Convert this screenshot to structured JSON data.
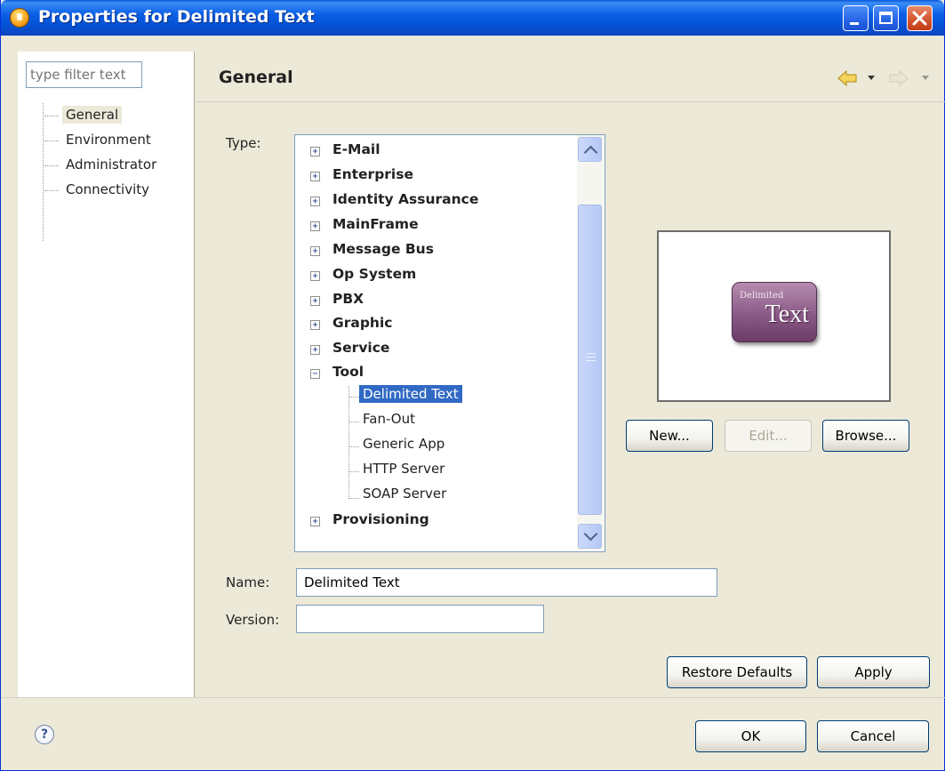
{
  "window": {
    "title": "Properties for Delimited Text"
  },
  "filter": {
    "placeholder": "type filter text",
    "value": "type filter text"
  },
  "nav": {
    "items": [
      {
        "label": "General",
        "selected": true
      },
      {
        "label": "Environment"
      },
      {
        "label": "Administrator"
      },
      {
        "label": "Connectivity"
      }
    ]
  },
  "page": {
    "title": "General"
  },
  "type_label": "Type:",
  "tree": {
    "categories": [
      "E-Mail",
      "Enterprise",
      "Identity Assurance",
      "MainFrame",
      "Message Bus",
      "Op System",
      "PBX",
      "Graphic",
      "Service",
      "Tool"
    ],
    "tool_children": [
      {
        "label": "Delimited Text",
        "selected": true
      },
      {
        "label": "Fan-Out"
      },
      {
        "label": "Generic App"
      },
      {
        "label": "HTTP Server"
      },
      {
        "label": "SOAP Server"
      }
    ],
    "last_category": "Provisioning"
  },
  "preview": {
    "small_text": "Delimited",
    "big_text": "Text"
  },
  "buttons": {
    "new": "New...",
    "edit": "Edit...",
    "browse": "Browse...",
    "restore_defaults": "Restore Defaults",
    "apply": "Apply",
    "ok": "OK",
    "cancel": "Cancel"
  },
  "fields": {
    "name_label": "Name:",
    "name_value": "Delimited Text",
    "version_label": "Version:",
    "version_value": ""
  },
  "help": {
    "glyph": "?"
  },
  "colors": {
    "selection": "#316ac5",
    "titlebar": "#0a5fe6",
    "dialog_bg": "#ece9d8"
  }
}
